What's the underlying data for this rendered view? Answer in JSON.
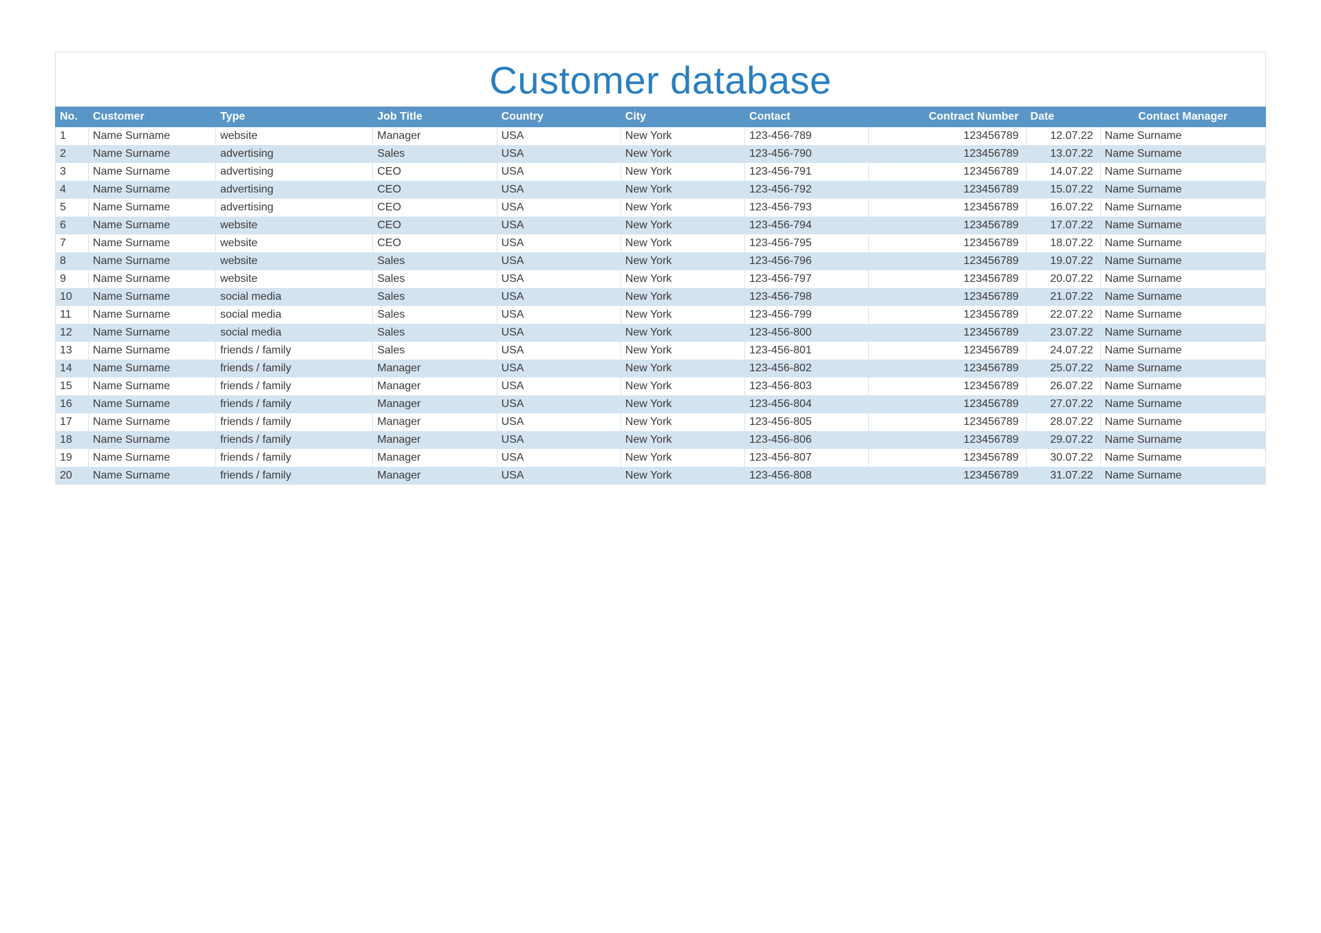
{
  "title": "Customer database",
  "columns": [
    "No.",
    "Customer",
    "Type",
    "Job Title",
    "Country",
    "City",
    "Contact",
    "Contract Number",
    "Date",
    "Contact Manager"
  ],
  "rows": [
    {
      "no": "1",
      "customer": "Name Surname",
      "type": "website",
      "job": "Manager",
      "country": "USA",
      "city": "New York",
      "contact": "123-456-789",
      "contract": "123456789",
      "date": "12.07.22",
      "manager": "Name Surname"
    },
    {
      "no": "2",
      "customer": "Name Surname",
      "type": "advertising",
      "job": "Sales",
      "country": "USA",
      "city": "New York",
      "contact": "123-456-790",
      "contract": "123456789",
      "date": "13.07.22",
      "manager": "Name Surname"
    },
    {
      "no": "3",
      "customer": "Name Surname",
      "type": "advertising",
      "job": "CEO",
      "country": "USA",
      "city": "New York",
      "contact": "123-456-791",
      "contract": "123456789",
      "date": "14.07.22",
      "manager": "Name Surname"
    },
    {
      "no": "4",
      "customer": "Name Surname",
      "type": "advertising",
      "job": "CEO",
      "country": "USA",
      "city": "New York",
      "contact": "123-456-792",
      "contract": "123456789",
      "date": "15.07.22",
      "manager": "Name Surname"
    },
    {
      "no": "5",
      "customer": "Name Surname",
      "type": "advertising",
      "job": "CEO",
      "country": "USA",
      "city": "New York",
      "contact": "123-456-793",
      "contract": "123456789",
      "date": "16.07.22",
      "manager": "Name Surname"
    },
    {
      "no": "6",
      "customer": "Name Surname",
      "type": "website",
      "job": "CEO",
      "country": "USA",
      "city": "New York",
      "contact": "123-456-794",
      "contract": "123456789",
      "date": "17.07.22",
      "manager": "Name Surname"
    },
    {
      "no": "7",
      "customer": "Name Surname",
      "type": "website",
      "job": "CEO",
      "country": "USA",
      "city": "New York",
      "contact": "123-456-795",
      "contract": "123456789",
      "date": "18.07.22",
      "manager": "Name Surname"
    },
    {
      "no": "8",
      "customer": "Name Surname",
      "type": "website",
      "job": "Sales",
      "country": "USA",
      "city": "New York",
      "contact": "123-456-796",
      "contract": "123456789",
      "date": "19.07.22",
      "manager": "Name Surname"
    },
    {
      "no": "9",
      "customer": "Name Surname",
      "type": "website",
      "job": "Sales",
      "country": "USA",
      "city": "New York",
      "contact": "123-456-797",
      "contract": "123456789",
      "date": "20.07.22",
      "manager": "Name Surname"
    },
    {
      "no": "10",
      "customer": "Name Surname",
      "type": "social media",
      "job": "Sales",
      "country": "USA",
      "city": "New York",
      "contact": "123-456-798",
      "contract": "123456789",
      "date": "21.07.22",
      "manager": "Name Surname"
    },
    {
      "no": "11",
      "customer": "Name Surname",
      "type": "social media",
      "job": "Sales",
      "country": "USA",
      "city": "New York",
      "contact": "123-456-799",
      "contract": "123456789",
      "date": "22.07.22",
      "manager": "Name Surname"
    },
    {
      "no": "12",
      "customer": "Name Surname",
      "type": "social media",
      "job": "Sales",
      "country": "USA",
      "city": "New York",
      "contact": "123-456-800",
      "contract": "123456789",
      "date": "23.07.22",
      "manager": "Name Surname"
    },
    {
      "no": "13",
      "customer": "Name Surname",
      "type": "friends / family",
      "job": "Sales",
      "country": "USA",
      "city": "New York",
      "contact": "123-456-801",
      "contract": "123456789",
      "date": "24.07.22",
      "manager": "Name Surname"
    },
    {
      "no": "14",
      "customer": "Name Surname",
      "type": "friends / family",
      "job": "Manager",
      "country": "USA",
      "city": "New York",
      "contact": "123-456-802",
      "contract": "123456789",
      "date": "25.07.22",
      "manager": "Name Surname"
    },
    {
      "no": "15",
      "customer": "Name Surname",
      "type": "friends / family",
      "job": "Manager",
      "country": "USA",
      "city": "New York",
      "contact": "123-456-803",
      "contract": "123456789",
      "date": "26.07.22",
      "manager": "Name Surname"
    },
    {
      "no": "16",
      "customer": "Name Surname",
      "type": "friends / family",
      "job": "Manager",
      "country": "USA",
      "city": "New York",
      "contact": "123-456-804",
      "contract": "123456789",
      "date": "27.07.22",
      "manager": "Name Surname"
    },
    {
      "no": "17",
      "customer": "Name Surname",
      "type": "friends / family",
      "job": "Manager",
      "country": "USA",
      "city": "New York",
      "contact": "123-456-805",
      "contract": "123456789",
      "date": "28.07.22",
      "manager": "Name Surname"
    },
    {
      "no": "18",
      "customer": "Name Surname",
      "type": "friends / family",
      "job": "Manager",
      "country": "USA",
      "city": "New York",
      "contact": "123-456-806",
      "contract": "123456789",
      "date": "29.07.22",
      "manager": "Name Surname"
    },
    {
      "no": "19",
      "customer": "Name Surname",
      "type": "friends / family",
      "job": "Manager",
      "country": "USA",
      "city": "New York",
      "contact": "123-456-807",
      "contract": "123456789",
      "date": "30.07.22",
      "manager": "Name Surname"
    },
    {
      "no": "20",
      "customer": "Name Surname",
      "type": "friends / family",
      "job": "Manager",
      "country": "USA",
      "city": "New York",
      "contact": "123-456-808",
      "contract": "123456789",
      "date": "31.07.22",
      "manager": "Name Surname"
    }
  ]
}
